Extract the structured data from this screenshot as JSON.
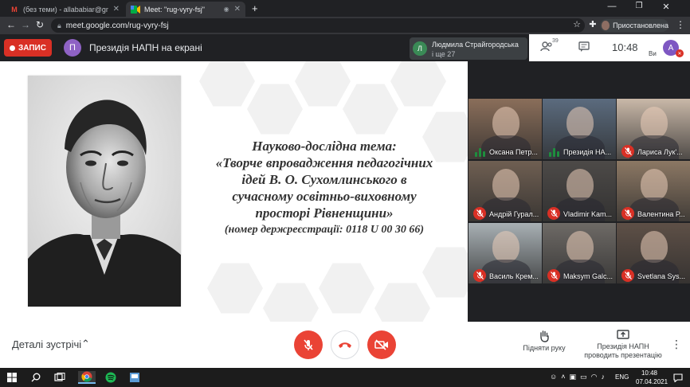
{
  "browser": {
    "tabs": [
      {
        "title": "(без теми) - allababiar@gmail.co",
        "favicon": "gmail-icon",
        "active": false
      },
      {
        "title": "Meet: \"rug-vyry-fsj\"",
        "favicon": "meet-icon",
        "active": true
      }
    ],
    "new_tab_label": "+",
    "url": "meet.google.com/rug-vyry-fsj",
    "profile_label": "Приостановлена"
  },
  "meet": {
    "record_label": "ЗАПИС",
    "presenter_initial": "П",
    "presenter_title": "Президія НАПН на екрані",
    "speaker": {
      "initial": "Л",
      "name": "Людмила Страйгородська",
      "more": "і ще 27"
    },
    "participant_count": "39",
    "clock": "10:48",
    "you_initial": "A",
    "you_label": "Ви"
  },
  "slide": {
    "line1": "Науково-дослідна тема:",
    "line2": "«Творче впровадження педагогічних",
    "line3": "ідей В. О. Сухомлинського в",
    "line4": "сучасному освітньо-виховному",
    "line5": "просторі Рівненщини»",
    "line6": "(номер держреєстрації: 0118 U 00 30 66)"
  },
  "participants": [
    {
      "name": "Оксана Петр...",
      "muted": false,
      "bg": "#8a6e5a"
    },
    {
      "name": "Президія НА...",
      "muted": false,
      "bg": "#5b6b7e"
    },
    {
      "name": "Лариса Лук'...",
      "muted": true,
      "bg": "#c9b8a8"
    },
    {
      "name": "Андрій Гурал...",
      "muted": true,
      "bg": "#6f5f52"
    },
    {
      "name": "Vladimir Kam...",
      "muted": true,
      "bg": "#4d4a48"
    },
    {
      "name": "Валентина Р...",
      "muted": true,
      "bg": "#8c7864"
    },
    {
      "name": "Василь Крем...",
      "muted": true,
      "bg": "#a8b0b4"
    },
    {
      "name": "Maksym Galc...",
      "muted": true,
      "bg": "#6e6a66"
    },
    {
      "name": "Svetlana Sys...",
      "muted": true,
      "bg": "#5e5047"
    }
  ],
  "controls": {
    "meeting_details": "Деталі зустрічі",
    "raise_hand": "Підняти руку",
    "present_line1": "Президія НАПН",
    "present_line2": "проводить презентацію"
  },
  "taskbar": {
    "lang": "ENG",
    "time": "10:48",
    "date": "07.04.2021"
  },
  "colors": {
    "danger": "#ea4335",
    "record": "#d93025",
    "chrome_dark": "#202124"
  }
}
